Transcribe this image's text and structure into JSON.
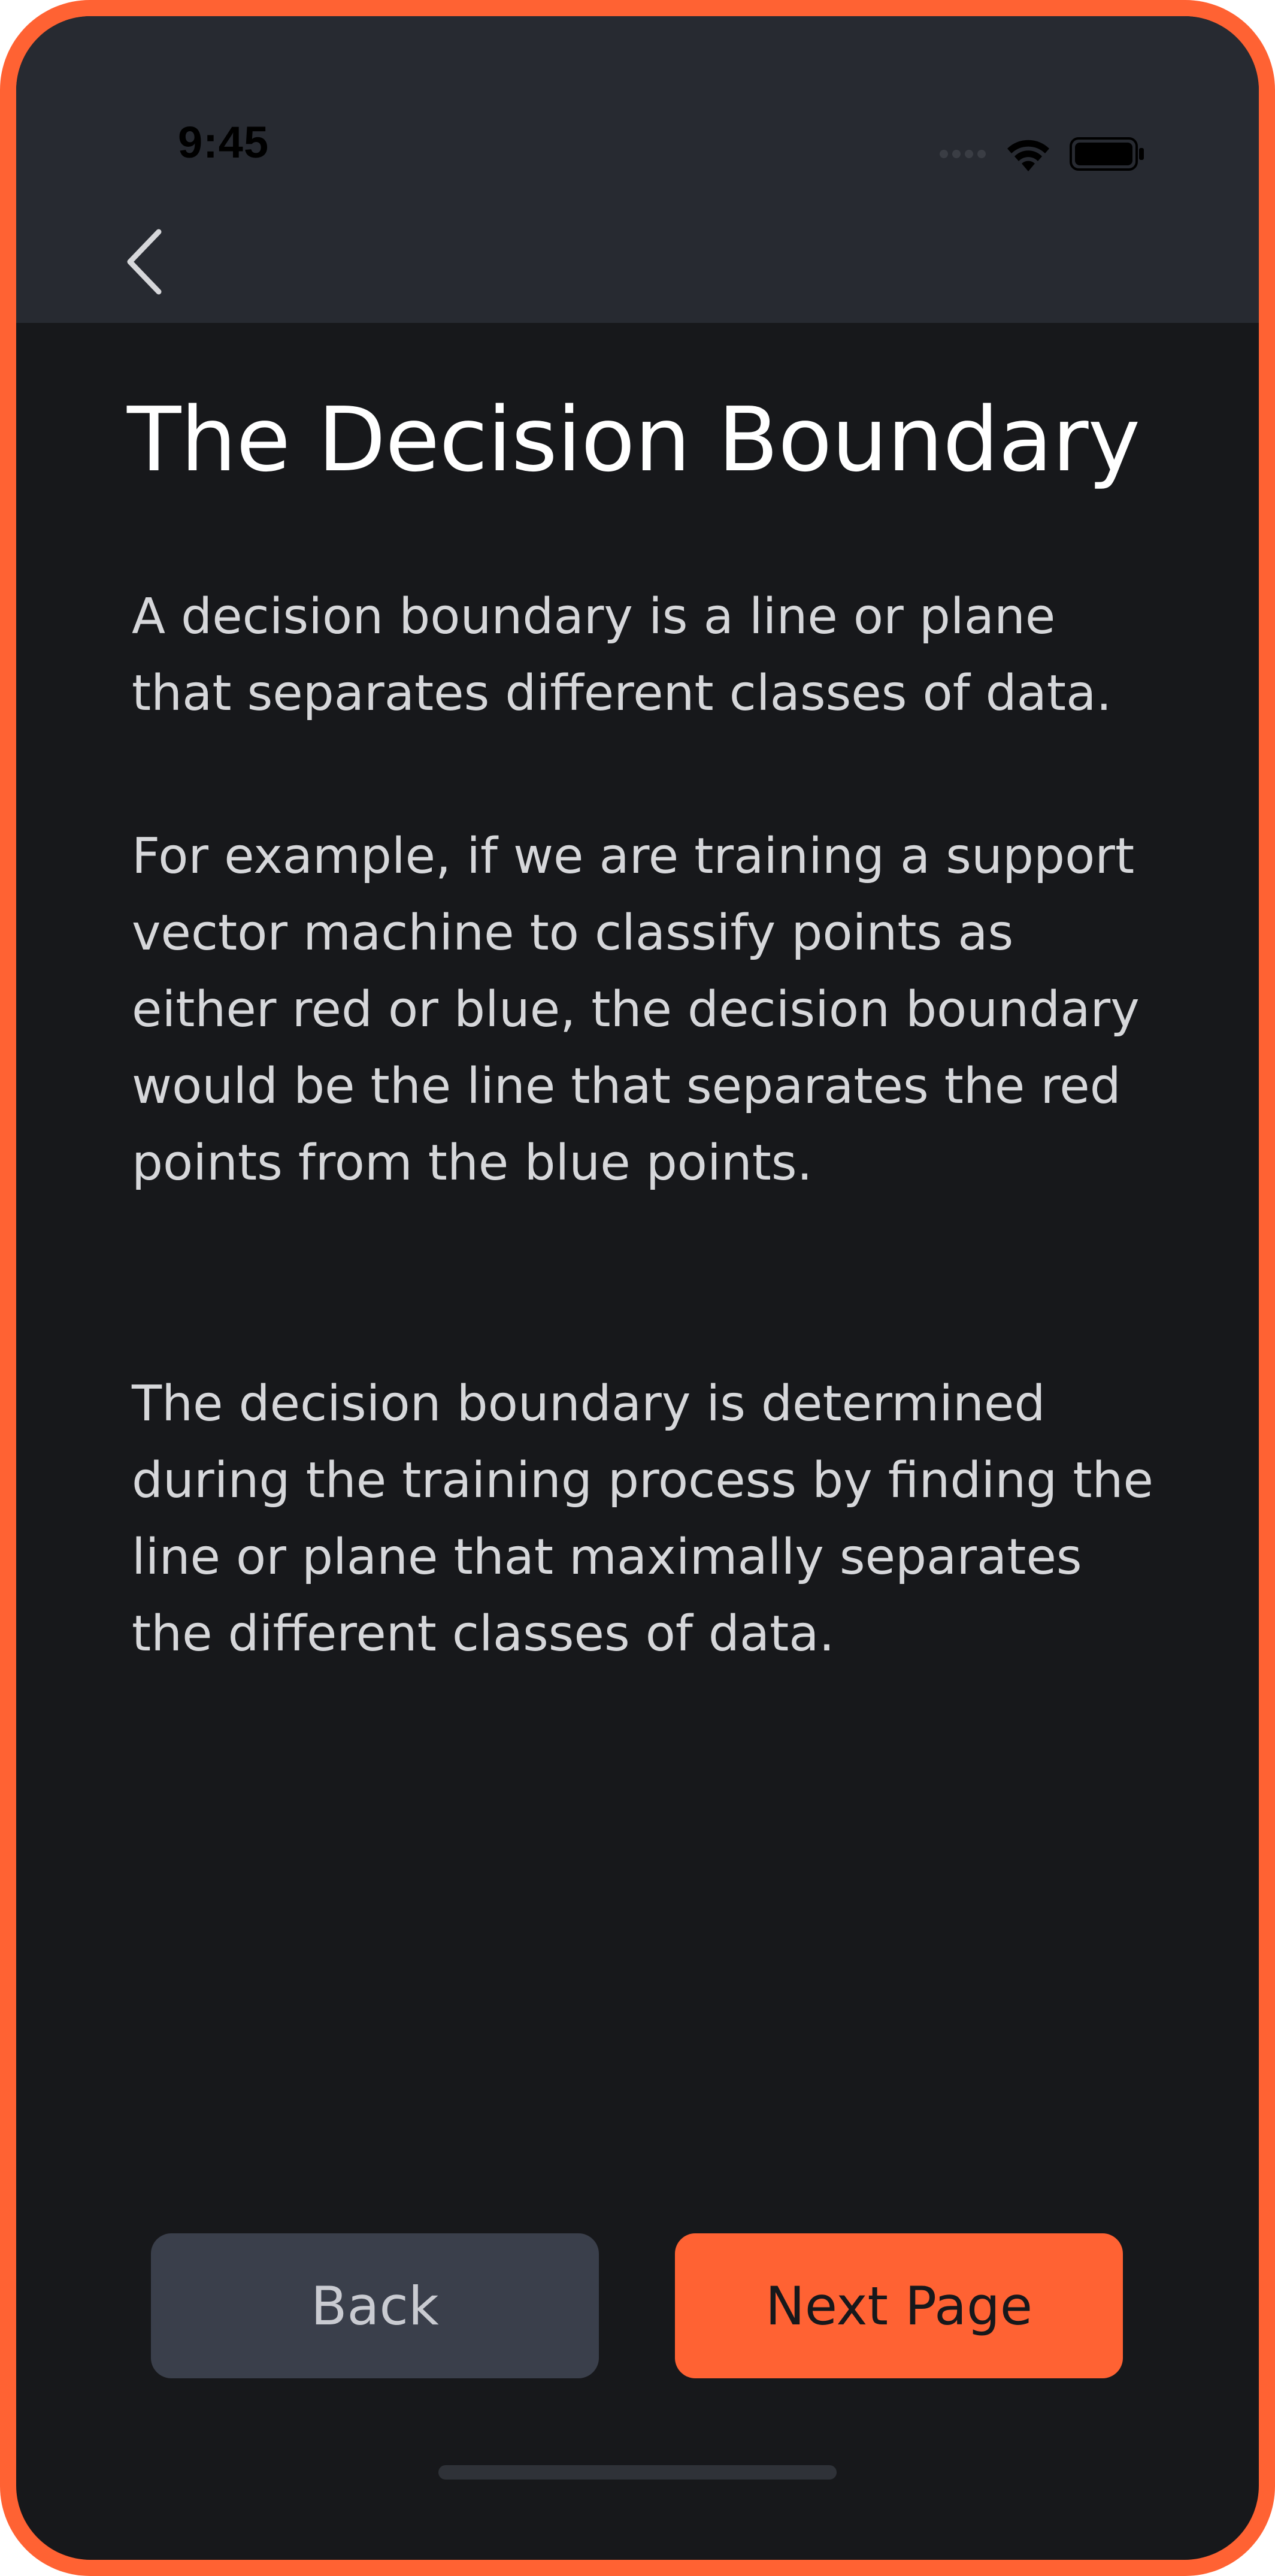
{
  "status_bar": {
    "time": "9:45",
    "icons": [
      "signal-dots-icon",
      "wifi-icon",
      "battery-icon"
    ]
  },
  "nav": {
    "back_icon": "chevron-left-icon"
  },
  "page": {
    "title": "The Decision Boundary",
    "paragraphs": [
      "A decision boundary is a line or plane that separates different classes of data.",
      "For example, if we are training a support vector machine to classify points as either red or blue, the decision boundary would be the line that separates the red points from the blue points.",
      "The decision boundary is determined during the training process by finding the line or plane that maximally separates the different classes of data."
    ]
  },
  "buttons": {
    "back_label": "Back",
    "next_label": "Next Page"
  },
  "colors": {
    "accent": "#FF6233",
    "background": "#17181B",
    "top_bar": "#272A31",
    "secondary_button": "#3A3F4B"
  }
}
